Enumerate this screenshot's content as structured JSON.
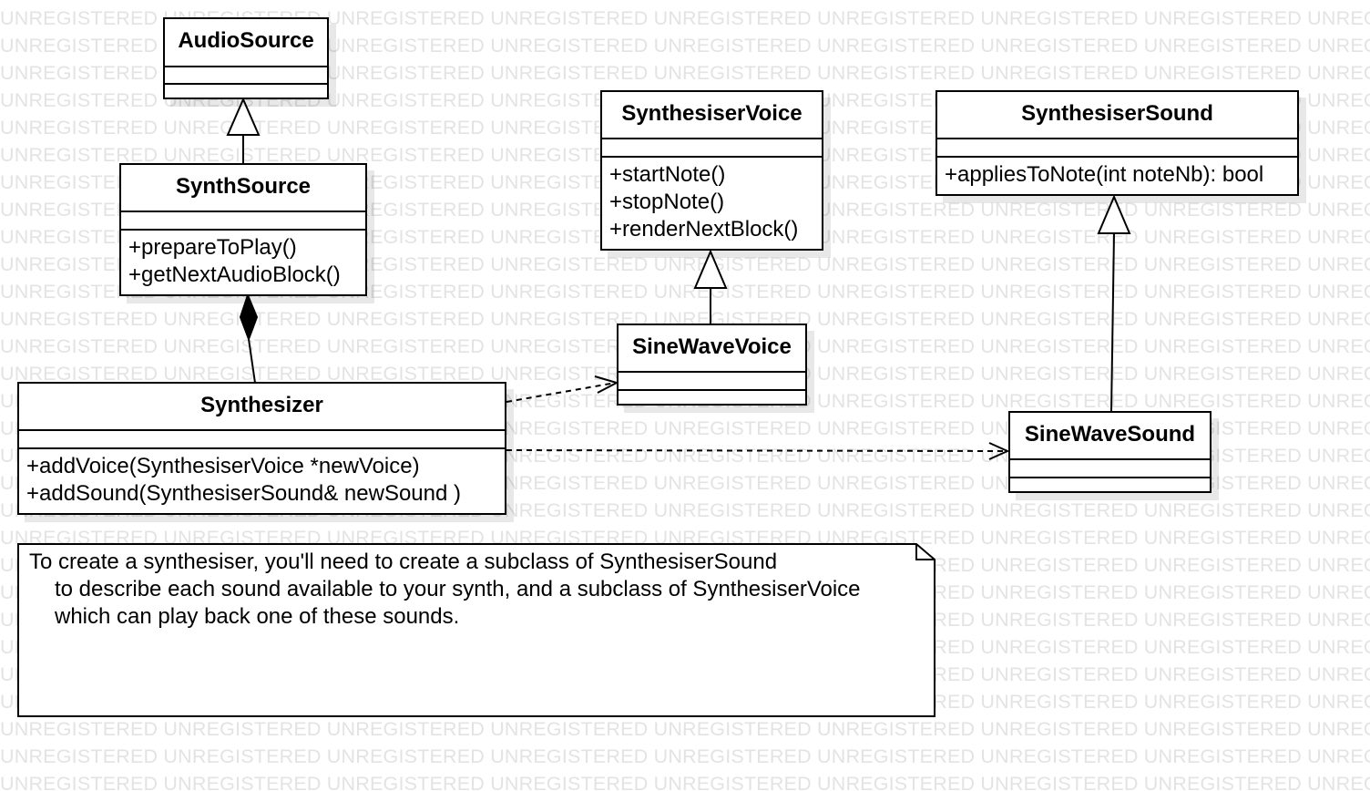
{
  "watermark": {
    "text": "UNREGISTERED",
    "color": "#e3e3e3"
  },
  "classes": {
    "audio_source": {
      "name": "AudioSource",
      "operations": []
    },
    "synth_source": {
      "name": "SynthSource",
      "operations": [
        "+prepareToPlay()",
        "+getNextAudioBlock()"
      ]
    },
    "synthesiser_voice": {
      "name": "SynthesiserVoice",
      "operations": [
        "+startNote()",
        "+stopNote()",
        "+renderNextBlock()"
      ]
    },
    "synthesiser_sound": {
      "name": "SynthesiserSound",
      "operations": [
        "+appliesToNote(int noteNb): bool"
      ]
    },
    "sine_wave_voice": {
      "name": "SineWaveVoice",
      "operations": []
    },
    "synthesizer": {
      "name": "Synthesizer",
      "operations": [
        "+addVoice(SynthesiserVoice *newVoice)",
        "+addSound(SynthesiserSound& newSound )"
      ]
    },
    "sine_wave_sound": {
      "name": "SineWaveSound",
      "operations": []
    }
  },
  "note": {
    "lines": [
      "To create a synthesiser, you'll need to create a subclass of SynthesiserSound",
      "to describe each sound available to your synth, and a subclass of SynthesiserVoice",
      "which can play back one of these sounds."
    ]
  },
  "relationships": [
    {
      "type": "generalization",
      "from": "SynthSource",
      "to": "AudioSource"
    },
    {
      "type": "composition",
      "from": "Synthesizer",
      "to": "SynthSource"
    },
    {
      "type": "generalization",
      "from": "SineWaveVoice",
      "to": "SynthesiserVoice"
    },
    {
      "type": "generalization",
      "from": "SineWaveSound",
      "to": "SynthesiserSound"
    },
    {
      "type": "dependency",
      "from": "Synthesizer",
      "to": "SineWaveVoice"
    },
    {
      "type": "dependency",
      "from": "Synthesizer",
      "to": "SineWaveSound"
    }
  ]
}
